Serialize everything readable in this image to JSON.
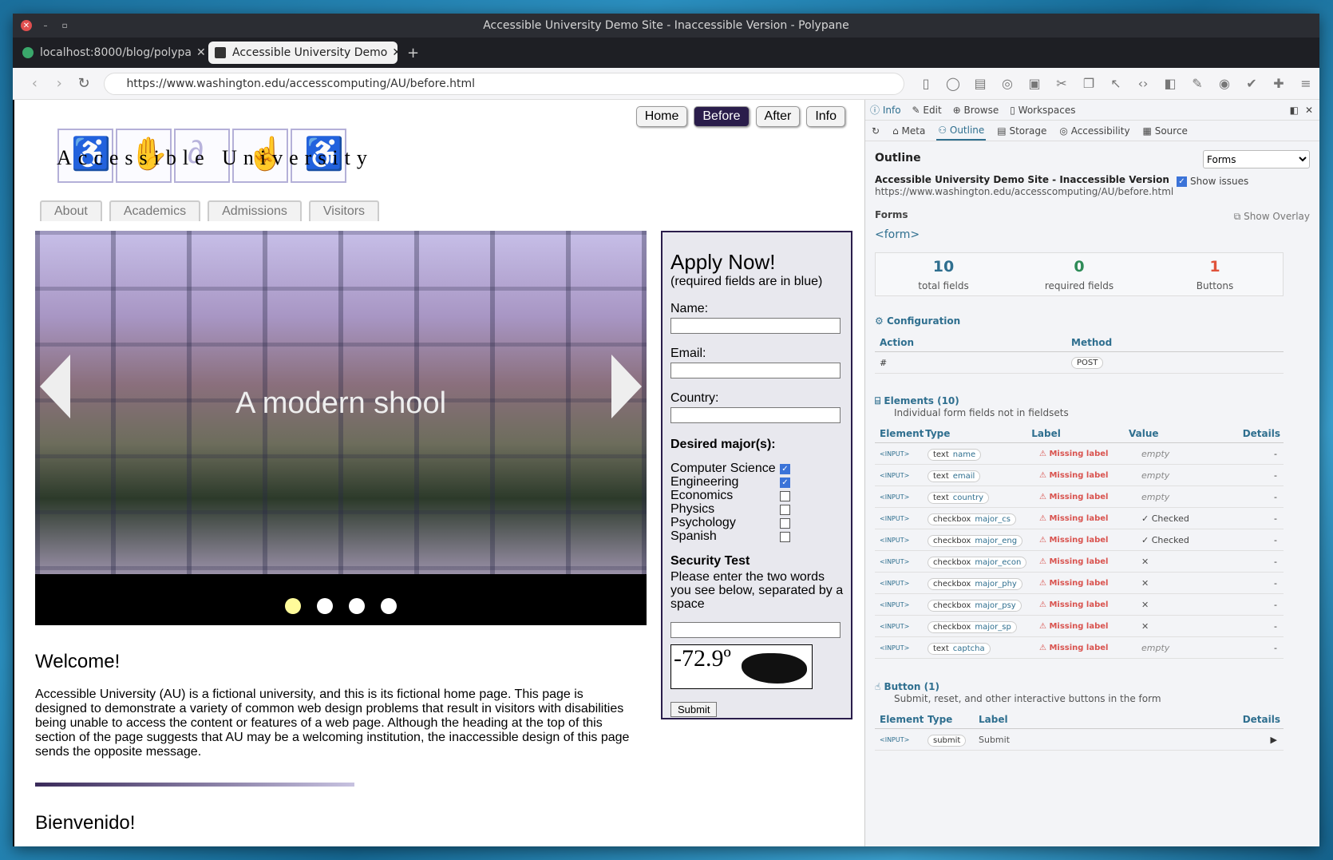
{
  "window": {
    "title": "Accessible University Demo Site - Inaccessible Version - Polypane"
  },
  "tabs": [
    {
      "label": "localhost:8000/blog/polypa",
      "active": false
    },
    {
      "label": "Accessible University Demo",
      "active": true
    }
  ],
  "toolbar": {
    "url": "https://www.washington.edu/accesscomputing/AU/before.html"
  },
  "site": {
    "nav": [
      "Home",
      "Before",
      "After",
      "Info"
    ],
    "logo_text": "Accessible University",
    "tabs": [
      "About",
      "Academics",
      "Admissions",
      "Visitors"
    ],
    "slider": {
      "caption": "A modern shool"
    },
    "welcome": "Welcome!",
    "intro": "Accessible University (AU) is a fictional university, and this is its fictional home page. This page is designed to demonstrate a variety of common web design problems that result in visitors with disabilities being unable to access the content or features of a web page. Although the heading at the top of this section of the page suggests that AU may be a welcoming institution, the inaccessible design of this page sends the opposite message.",
    "bienvenido": "Bienvenido!",
    "form": {
      "title": "Apply Now!",
      "required_note": "(required fields are in blue)",
      "name_label": "Name:",
      "email_label": "Email:",
      "country_label": "Country:",
      "majors_heading": "Desired major(s):",
      "majors": [
        {
          "label": "Computer Science",
          "checked": true
        },
        {
          "label": "Engineering",
          "checked": true
        },
        {
          "label": "Economics",
          "checked": false
        },
        {
          "label": "Physics",
          "checked": false
        },
        {
          "label": "Psychology",
          "checked": false
        },
        {
          "label": "Spanish",
          "checked": false
        }
      ],
      "security_heading": "Security Test",
      "security_text": "Please enter the two words you see below, separated by a space",
      "captcha_text": "-72.9º",
      "submit": "Submit"
    }
  },
  "devtools": {
    "top_tabs": [
      "Info",
      "Edit",
      "Browse",
      "Workspaces"
    ],
    "sub_tabs": [
      "Meta",
      "Outline",
      "Storage",
      "Accessibility",
      "Source"
    ],
    "active_sub": "Outline",
    "heading": "Outline",
    "select_value": "Forms",
    "page_title": "Accessible University Demo Site - Inaccessible Version",
    "page_url": "https://www.washington.edu/accesscomputing/AU/before.html",
    "show_issues": "Show issues",
    "forms_label": "Forms",
    "show_overlay": "Show Overlay",
    "form_tag": "<form>",
    "stats": [
      {
        "value": "10",
        "label": "total fields",
        "color": "#2f6f8f"
      },
      {
        "value": "0",
        "label": "required fields",
        "color": "#2e8b57"
      },
      {
        "value": "1",
        "label": "Buttons",
        "color": "#e0533b"
      }
    ],
    "configuration": "Configuration",
    "config_headers": [
      "Action",
      "Method"
    ],
    "config_values": [
      "#",
      "POST"
    ],
    "elements_title": "Elements (10)",
    "elements_sub": "Individual form fields not in fieldsets",
    "element_headers": [
      "Element",
      "Type",
      "Label",
      "Value",
      "Details"
    ],
    "elements": [
      {
        "el": "<INPUT>",
        "type": "text",
        "name": "name",
        "label": "Missing label",
        "value": "empty",
        "details": "-"
      },
      {
        "el": "<INPUT>",
        "type": "text",
        "name": "email",
        "label": "Missing label",
        "value": "empty",
        "details": "-"
      },
      {
        "el": "<INPUT>",
        "type": "text",
        "name": "country",
        "label": "Missing label",
        "value": "empty",
        "details": "-"
      },
      {
        "el": "<INPUT>",
        "type": "checkbox",
        "name": "major_cs",
        "label": "Missing label",
        "value": "✓ Checked",
        "details": "-"
      },
      {
        "el": "<INPUT>",
        "type": "checkbox",
        "name": "major_eng",
        "label": "Missing label",
        "value": "✓ Checked",
        "details": "-"
      },
      {
        "el": "<INPUT>",
        "type": "checkbox",
        "name": "major_econ",
        "label": "Missing label",
        "value": "✕",
        "details": "-"
      },
      {
        "el": "<INPUT>",
        "type": "checkbox",
        "name": "major_phy",
        "label": "Missing label",
        "value": "✕",
        "details": "-"
      },
      {
        "el": "<INPUT>",
        "type": "checkbox",
        "name": "major_psy",
        "label": "Missing label",
        "value": "✕",
        "details": "-"
      },
      {
        "el": "<INPUT>",
        "type": "checkbox",
        "name": "major_sp",
        "label": "Missing label",
        "value": "✕",
        "details": "-"
      },
      {
        "el": "<INPUT>",
        "type": "text",
        "name": "captcha",
        "label": "Missing label",
        "value": "empty",
        "details": "-"
      }
    ],
    "button_title": "Button (1)",
    "button_sub": "Submit, reset, and other interactive buttons in the form",
    "button_headers": [
      "Element",
      "Type",
      "Label",
      "Details"
    ],
    "button_row": {
      "el": "<INPUT>",
      "type": "submit",
      "label": "Submit",
      "details": "▶"
    }
  }
}
